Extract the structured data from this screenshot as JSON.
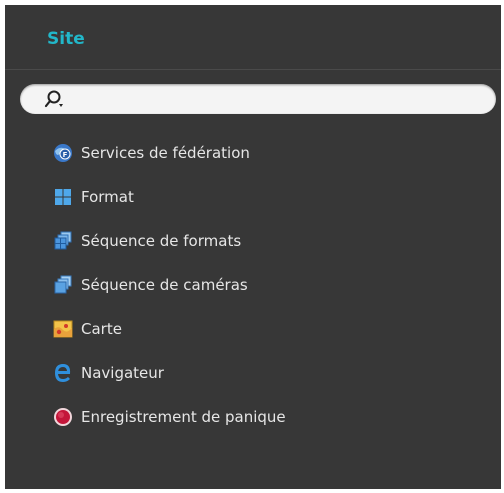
{
  "panel": {
    "title": "Site",
    "search": {
      "value": "",
      "placeholder": ""
    },
    "items": [
      {
        "label": "Services de fédération",
        "icon": "federation-icon"
      },
      {
        "label": "Format",
        "icon": "layout-grid-icon"
      },
      {
        "label": "Séquence de formats",
        "icon": "layout-sequence-icon"
      },
      {
        "label": "Séquence de caméras",
        "icon": "camera-sequence-icon"
      },
      {
        "label": "Carte",
        "icon": "map-icon"
      },
      {
        "label": "Navigateur",
        "icon": "browser-icon"
      },
      {
        "label": "Enregistrement de panique",
        "icon": "panic-record-icon"
      }
    ]
  },
  "colors": {
    "panel_bg": "#373737",
    "title": "#22b7c9",
    "text": "#e6e6e6"
  }
}
